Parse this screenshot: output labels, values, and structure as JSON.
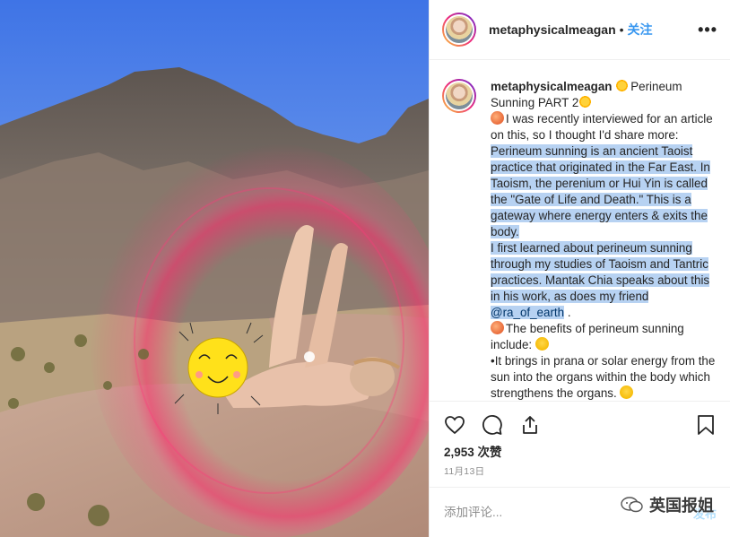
{
  "post": {
    "username": "metaphysicalmeagan",
    "dot": "•",
    "follow_label": "关注",
    "more_label": "•••"
  },
  "caption": {
    "username": "metaphysicalmeagan",
    "title": "Perineum Sunning PART 2",
    "line1": "I was recently interviewed for an article on this, so I thought I'd share more:",
    "para1": "Perineum sunning is an ancient Taoist practice that originated in the Far East. In Taoism, the perenium or Hui Yin is called the \"Gate of Life and Death.\" This is a gateway where energy enters & exits the body.",
    "para2_a": "I first learned about perineum sunning through my studies of Taoism and Tantric practices. Mantak Chia speaks about this in his work, as does my friend",
    "mention": "@ra_of_earth",
    "para2_end": ".",
    "benefits": "The benefits of perineum sunning include:",
    "bullet1": "•It brings in prana or solar energy from the sun into the organs within the body which strengthens the organs."
  },
  "engagement": {
    "likes": "2,953 次赞",
    "date": "11月13日"
  },
  "comment": {
    "placeholder": "添加评论...",
    "post_label": "发布"
  },
  "watermark": {
    "text": "英国报姐"
  },
  "colors": {
    "accent": "#3897f0",
    "highlight": "#b7d2f2",
    "sky": "#4f7fe0",
    "glow": "#ff2a6d"
  },
  "icons": [
    "heart-icon",
    "comment-icon",
    "share-icon",
    "bookmark-icon",
    "more-icon",
    "wechat-icon",
    "sun-emoji-icon",
    "peach-emoji-icon",
    "smile-emoji-icon",
    "smiley-sticker"
  ]
}
